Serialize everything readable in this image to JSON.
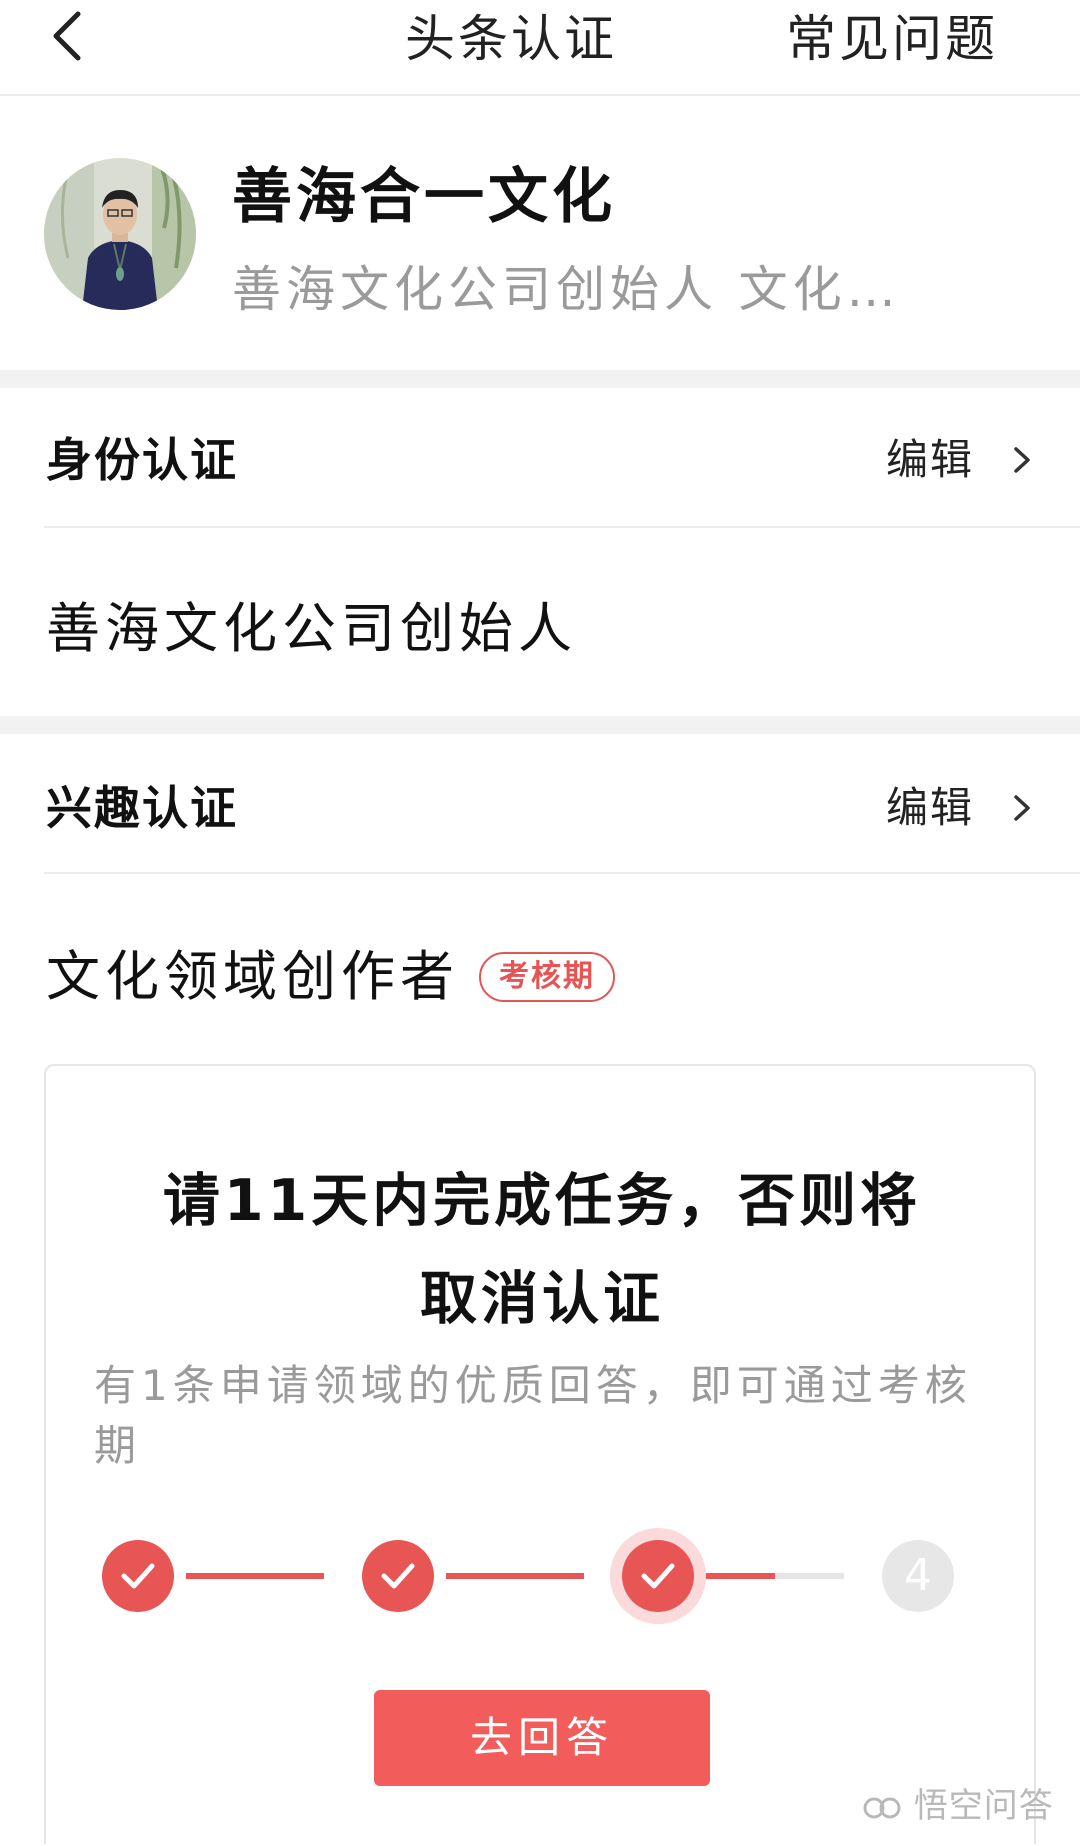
{
  "header": {
    "title": "头条认证",
    "faq_label": "常见问题"
  },
  "profile": {
    "name": "善海合一文化",
    "bio": "善海文化公司创始人  文化…"
  },
  "identity_section": {
    "title": "身份认证",
    "edit_label": "编辑",
    "value": "善海文化公司创始人"
  },
  "interest_section": {
    "title": "兴趣认证",
    "edit_label": "编辑",
    "field": "文化领域创作者",
    "badge": "考核期"
  },
  "task_card": {
    "title_line1": "请11天内完成任务，否则将",
    "title_line2": "取消认证",
    "description": "有1条申请领域的优质回答，即可通过考核期",
    "steps": [
      {
        "state": "done"
      },
      {
        "state": "done"
      },
      {
        "state": "current"
      },
      {
        "state": "pending",
        "label": "4"
      }
    ],
    "progress_into_last_connector": 0.5,
    "button_label": "去回答"
  },
  "watermark": {
    "text": "悟空问答"
  },
  "colors": {
    "accent": "#e85555",
    "button": "#f25c5a",
    "muted_text": "#9a9a9a",
    "divider": "#f2f2f2"
  },
  "icons": {
    "back": "chevron-left-icon",
    "edit_arrow": "chevron-right-icon",
    "step_done": "check-icon",
    "watermark_logo": "wukong-logo-icon"
  }
}
